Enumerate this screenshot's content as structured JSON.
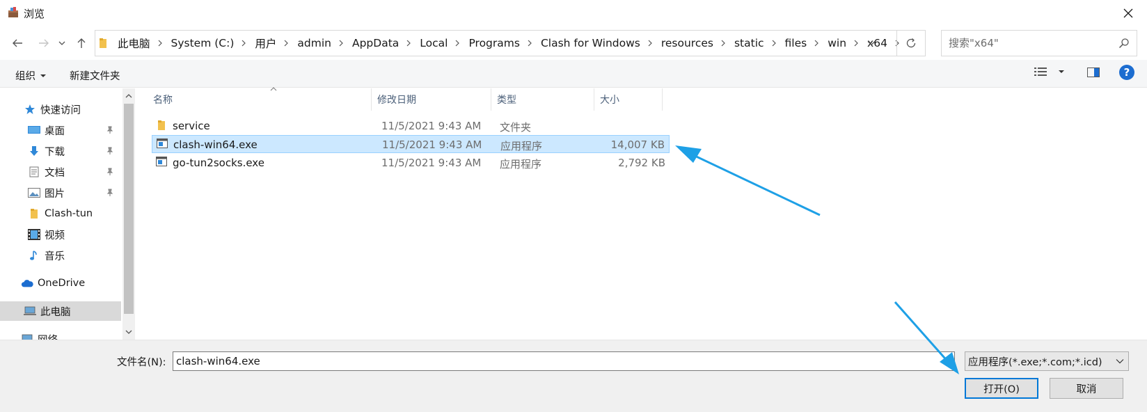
{
  "window": {
    "title": "浏览",
    "app_icon": "package-icon",
    "close_icon": "close-icon"
  },
  "nav": {
    "back_icon": "arrow-left-icon",
    "forward_icon": "arrow-right-icon",
    "recent_icon": "chevron-down-icon",
    "up_icon": "arrow-up-icon",
    "breadcrumbs": [
      "此电脑",
      "System (C:)",
      "用户",
      "admin",
      "AppData",
      "Local",
      "Programs",
      "Clash for Windows",
      "resources",
      "static",
      "files",
      "win",
      "x64"
    ],
    "search_placeholder": "搜索\"x64\"",
    "search_icon": "search-icon",
    "refresh_icon": "refresh-icon"
  },
  "toolbar": {
    "organize_label": "组织",
    "new_folder_label": "新建文件夹",
    "help_label": "?"
  },
  "sidebar": {
    "items": [
      {
        "label": "快速访问",
        "icon": "star-icon",
        "pinned": false,
        "selected": false
      },
      {
        "label": "桌面",
        "icon": "desktop-icon",
        "pinned": true,
        "selected": false
      },
      {
        "label": "下载",
        "icon": "download-icon",
        "pinned": true,
        "selected": false
      },
      {
        "label": "文档",
        "icon": "document-icon",
        "pinned": true,
        "selected": false
      },
      {
        "label": "图片",
        "icon": "picture-icon",
        "pinned": true,
        "selected": false
      },
      {
        "label": "Clash-tun",
        "icon": "folder-icon",
        "pinned": false,
        "selected": false
      },
      {
        "label": "视频",
        "icon": "video-icon",
        "pinned": false,
        "selected": false
      },
      {
        "label": "音乐",
        "icon": "music-icon",
        "pinned": false,
        "selected": false
      },
      {
        "label": "OneDrive",
        "icon": "cloud-icon",
        "pinned": false,
        "selected": false
      },
      {
        "label": "此电脑",
        "icon": "computer-icon",
        "pinned": false,
        "selected": true
      },
      {
        "label": "网络",
        "icon": "network-icon",
        "pinned": false,
        "selected": false
      }
    ]
  },
  "filelist": {
    "columns": [
      "名称",
      "修改日期",
      "类型",
      "大小"
    ],
    "rows": [
      {
        "name": "service",
        "date": "11/5/2021 9:43 AM",
        "type": "文件夹",
        "size": "",
        "icon": "folder-icon",
        "selected": false
      },
      {
        "name": "clash-win64.exe",
        "date": "11/5/2021 9:43 AM",
        "type": "应用程序",
        "size": "14,007 KB",
        "icon": "exe-icon",
        "selected": true
      },
      {
        "name": "go-tun2socks.exe",
        "date": "11/5/2021 9:43 AM",
        "type": "应用程序",
        "size": "2,792 KB",
        "icon": "exe-icon",
        "selected": false
      }
    ]
  },
  "bottom": {
    "filename_label": "文件名(N):",
    "filename_value": "clash-win64.exe",
    "filter_value": "应用程序(*.exe;*.com;*.icd)",
    "open_label": "打开(O)",
    "cancel_label": "取消"
  },
  "colors": {
    "accent": "#0078d7",
    "selection": "#cce8ff",
    "annotation_arrow": "#1ea0e6"
  }
}
